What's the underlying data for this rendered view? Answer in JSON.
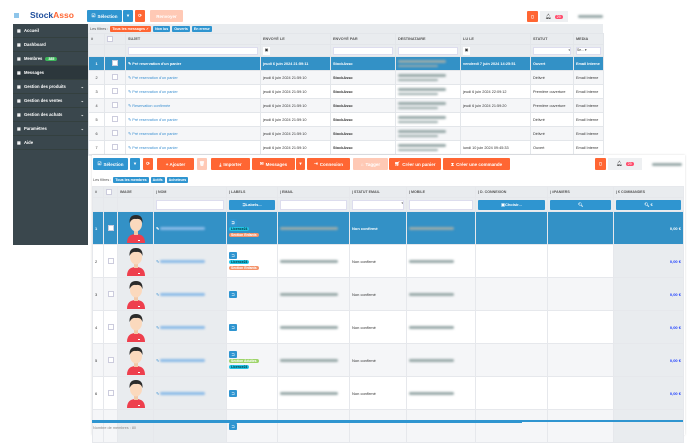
{
  "app": {
    "brand_a": "Stock",
    "brand_b": "Asso"
  },
  "colors": {
    "primary": "#2f95d0",
    "accent": "#ff6633",
    "sidebar": "#3a474d",
    "selected_row": "#3391c6"
  },
  "sidebar": {
    "items": [
      {
        "label": "Accueil",
        "icon": "home-icon"
      },
      {
        "label": "Dashboard",
        "icon": "dashboard-icon"
      },
      {
        "label": "Membres",
        "icon": "users-icon",
        "badge": "385"
      },
      {
        "label": "Messages",
        "icon": "messages-icon",
        "active": true
      },
      {
        "label": "Gestion des produits",
        "icon": "products-icon",
        "chevron": true
      },
      {
        "label": "Gestion des ventes",
        "icon": "cart-icon",
        "chevron": true
      },
      {
        "label": "Gestion des achats",
        "icon": "bag-icon",
        "chevron": true
      },
      {
        "label": "Paramètres",
        "icon": "gear-icon",
        "chevron": true
      },
      {
        "label": "Aide",
        "icon": "help-icon"
      }
    ]
  },
  "messages": {
    "toolbar": {
      "selection": "Sélection",
      "resend": "Renvoyer"
    },
    "notif_count": "29",
    "filters_label": "Les filtres :",
    "filters": [
      "Tous les messages ✓",
      "Non lus",
      "Ouverts",
      "En erreur"
    ],
    "columns": [
      "#",
      "",
      "SUJET",
      "ENVOYÉ LE",
      "ENVOYÉ PAR",
      "DESTINATAIRE",
      "LU LE",
      "STATUT",
      "MEDIA"
    ],
    "media_filter": "Se...",
    "rows": [
      {
        "n": "1",
        "subject": "Pré reservation d'un panier",
        "sent": "jeudi 6 juin 2024 21:59:11",
        "by": "StockAsso",
        "read": "vendredi 7 juin 2024 14:25:51",
        "status": "Ouvert",
        "media": "Email Interne"
      },
      {
        "n": "2",
        "subject": "Pré reservation d'un panier",
        "sent": "jeudi 6 juin 2024 21:59:10",
        "by": "StockAsso",
        "read": "",
        "status": "Délivré",
        "media": "Email Interne"
      },
      {
        "n": "3",
        "subject": "Pré reservation d'un panier",
        "sent": "jeudi 6 juin 2024 21:59:10",
        "by": "StockAsso",
        "read": "jeudi 6 juin 2024 22:09:12",
        "status": "Première ouverture",
        "media": "Email Interne"
      },
      {
        "n": "4",
        "subject": "Reservation confirmée",
        "sent": "jeudi 6 juin 2024 21:59:10",
        "by": "StockAsso",
        "read": "jeudi 6 juin 2024 21:59:20",
        "status": "Première ouverture",
        "media": "Email Interne"
      },
      {
        "n": "5",
        "subject": "Pré reservation d'un panier",
        "sent": "jeudi 6 juin 2024 21:59:10",
        "by": "StockAsso",
        "read": "",
        "status": "Délivré",
        "media": "Email Interne"
      },
      {
        "n": "6",
        "subject": "Pré reservation d'un panier",
        "sent": "jeudi 6 juin 2024 21:59:10",
        "by": "StockAsso",
        "read": "",
        "status": "Délivré",
        "media": "Email Interne"
      },
      {
        "n": "7",
        "subject": "Pré reservation d'un panier",
        "sent": "jeudi 6 juin 2024 21:59:10",
        "by": "StockAsso",
        "read": "lundi 10 juin 2024 09:45:33",
        "status": "Ouvert",
        "media": "Email Interne"
      }
    ]
  },
  "members": {
    "toolbar": {
      "selection": "Sélection",
      "add": "+ Ajouter",
      "import": "Importer",
      "messages": "Messages",
      "login": "Connexion",
      "tag": "Tagger",
      "create_cart": "Créer un panier",
      "create_order": "Créer une commande"
    },
    "notif_count": "29",
    "filters_label": "Les filtres :",
    "filters": [
      "Tous les membres",
      "Actifs",
      "Acheteurs"
    ],
    "columns": [
      "#",
      "",
      "IMAGE",
      "NOM",
      "LABELS",
      "EMAIL",
      "STATUT EMAIL",
      "MOBILE",
      "D. CONNEXION",
      "#PANIERS",
      "€ COMMANDES"
    ],
    "labels_button": "Labels...",
    "date_button": "Choisir...",
    "rows": [
      {
        "n": "1",
        "labels": [
          {
            "t": "Licence24",
            "c": "#22c5e8"
          },
          {
            "t": "Section Enfants",
            "c": "#f4936a"
          }
        ],
        "status": "Non confirmé",
        "orders": "0,00 €"
      },
      {
        "n": "2",
        "labels": [
          {
            "t": "Licence24",
            "c": "#22c5e8"
          },
          {
            "t": "Section Enfants",
            "c": "#f4936a"
          }
        ],
        "status": "Non confirmé",
        "orders": "0,00 €"
      },
      {
        "n": "3",
        "labels": [],
        "status": "Non confirmé",
        "orders": "0,00 €"
      },
      {
        "n": "4",
        "labels": [],
        "status": "Non confirmé",
        "orders": "0,00 €"
      },
      {
        "n": "5",
        "labels": [
          {
            "t": "Section Adultes",
            "c": "#9ed46a"
          },
          {
            "t": "Licence24",
            "c": "#22c5e8"
          }
        ],
        "status": "Non confirmé",
        "orders": "0,00 €"
      },
      {
        "n": "6",
        "labels": [],
        "status": "Non confirmé",
        "orders": "0,00 €"
      }
    ],
    "footer": "Nombre de membres : 80"
  }
}
